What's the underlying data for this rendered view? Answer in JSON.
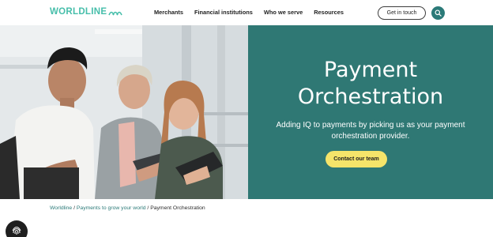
{
  "header": {
    "logo_text": "WORLDLINE",
    "nav": [
      {
        "label": "Merchants"
      },
      {
        "label": "Financial institutions"
      },
      {
        "label": "Who we serve"
      },
      {
        "label": "Resources"
      }
    ],
    "cta_label": "Get in touch",
    "search_icon": "search-icon"
  },
  "hero": {
    "title_line1": "Payment",
    "title_line2": "Orchestration",
    "subtitle": "Adding IQ to payments by picking us as your payment orchestration provider.",
    "cta_label": "Contact our team"
  },
  "breadcrumb": {
    "items": [
      {
        "label": "Worldline"
      },
      {
        "label": "Payments to grow your world"
      },
      {
        "label": "Payment Orchestration"
      }
    ],
    "separator": "/"
  },
  "colors": {
    "brand_teal": "#46beaa",
    "panel_teal": "#2f7874",
    "cta_yellow": "#f5e46a"
  }
}
